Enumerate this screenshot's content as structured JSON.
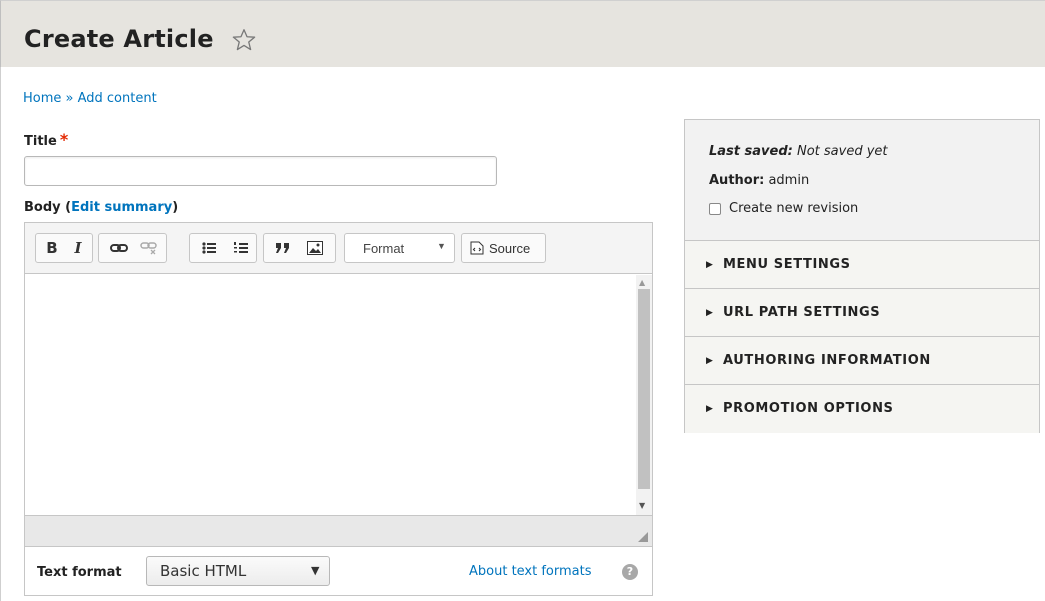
{
  "header": {
    "title": "Create Article"
  },
  "breadcrumb": {
    "home": "Home",
    "sep": " » ",
    "current": "Add content"
  },
  "title_field": {
    "label": "Title",
    "required_mark": "*",
    "value": ""
  },
  "body_field": {
    "label_prefix": "Body (",
    "edit_summary": "Edit summary",
    "label_suffix": ")"
  },
  "toolbar": {
    "format_label": "Format",
    "source_label": "Source"
  },
  "text_format": {
    "label": "Text format",
    "selected": "Basic HTML",
    "about_link": "About text formats",
    "help_glyph": "?"
  },
  "sidebar": {
    "last_saved_label": "Last saved:",
    "last_saved_value": "Not saved yet",
    "author_label": "Author:",
    "author_value": "admin",
    "revision_label": "Create new revision",
    "sections": [
      {
        "label": "MENU SETTINGS"
      },
      {
        "label": "URL PATH SETTINGS"
      },
      {
        "label": "AUTHORING INFORMATION"
      },
      {
        "label": "PROMOTION OPTIONS"
      }
    ]
  },
  "colors": {
    "link": "#0074bd",
    "required": "#e32700",
    "header_bg": "#e6e4df"
  }
}
